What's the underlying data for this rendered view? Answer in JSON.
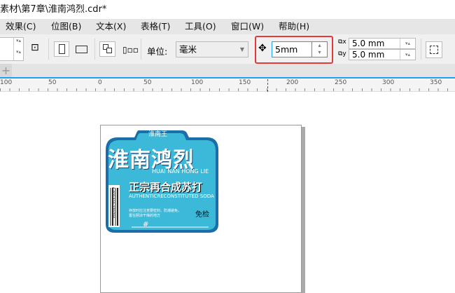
{
  "title": "素材\\第7章\\淮南鸿烈.cdr*",
  "menu": [
    "效果(C)",
    "位图(B)",
    "文本(X)",
    "表格(T)",
    "工具(O)",
    "窗口(W)",
    "帮助(H)"
  ],
  "toolbar": {
    "unit_label": "单位:",
    "unit_value": "毫米",
    "nudge_value": "5mm",
    "dup_x": "5.0 mm",
    "dup_y": "5.0 mm"
  },
  "ruler": [
    "100",
    "50",
    "0",
    "50",
    "100",
    "150",
    "200",
    "250",
    "300",
    "350"
  ],
  "label": {
    "brand_small": "淮南王",
    "title": "淮南鸿烈",
    "pinyin": "HUAI NAN HONG LIE",
    "subtitle": "正宗再合成苏打",
    "subtitle_en": "AUTHENTICRECONSTITUTED SODA",
    "note": "存放时应注意要密封、防潮避免，置在阴凉干燥的地方",
    "badge": "免检",
    "hash": "#",
    "barcode": "6 921310 270706",
    "colors": {
      "fill": "#3cb8d8",
      "border": "#1a6fa8"
    }
  }
}
